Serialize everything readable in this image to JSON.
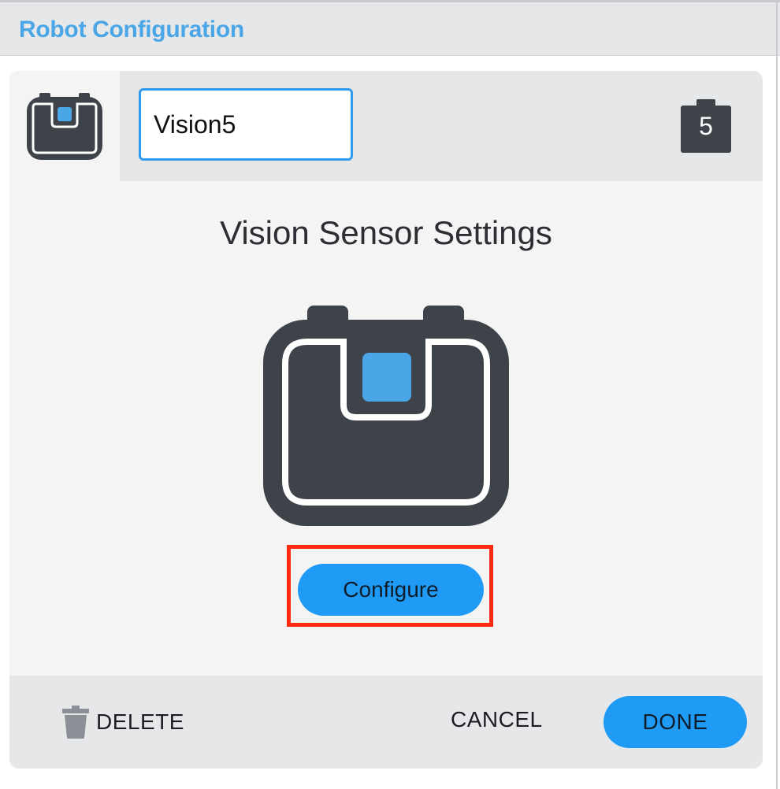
{
  "window": {
    "title": "Robot Configuration"
  },
  "device": {
    "name_value": "Vision5",
    "port_number": "5",
    "icon": "vision-sensor-icon"
  },
  "settings": {
    "title": "Vision Sensor Settings",
    "configure_label": "Configure"
  },
  "footer": {
    "delete_label": "DELETE",
    "delete_icon": "trash-icon",
    "cancel_label": "CANCEL",
    "done_label": "DONE"
  },
  "colors": {
    "accent": "#1f9bf5",
    "title_text": "#4aa6e6",
    "sensor_body": "#3e4249",
    "sensor_lens": "#4aa6e6",
    "highlight": "#ff2a12"
  }
}
